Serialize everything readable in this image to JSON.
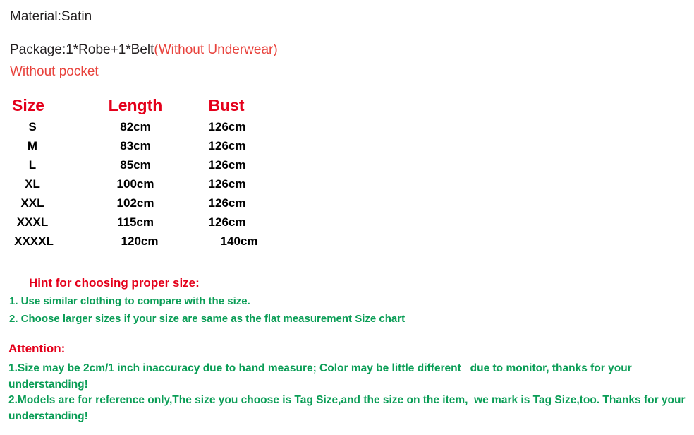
{
  "product_info": {
    "material_line": "Material:Satin",
    "package_label": "Package:1*Robe+1*Belt",
    "package_note": "(Without Underwear)",
    "pocket_note": "Without pocket"
  },
  "size_chart": {
    "headers": {
      "size": "Size",
      "length": "Length",
      "bust": "Bust"
    },
    "rows": [
      {
        "size": "S",
        "length": "82cm",
        "bust": "126cm"
      },
      {
        "size": "M",
        "length": "83cm",
        "bust": "126cm"
      },
      {
        "size": "L",
        "length": "85cm",
        "bust": "126cm"
      },
      {
        "size": "XL",
        "length": "100cm",
        "bust": "126cm"
      },
      {
        "size": "XXL",
        "length": "102cm",
        "bust": "126cm"
      },
      {
        "size": "XXXL",
        "length": "115cm",
        "bust": "126cm"
      },
      {
        "size": "XXXXL",
        "length": "120cm",
        "bust": "140cm"
      }
    ]
  },
  "hint": {
    "title": "Hint for choosing proper size:",
    "items": [
      "1. Use similar clothing to compare with the size.",
      "2. Choose larger sizes if your size are same as the flat measurement Size chart"
    ]
  },
  "attention": {
    "title": "Attention:",
    "items": [
      "1.Size may be 2cm/1 inch inaccuracy due to hand measure; Color may be little different   due to monitor, thanks for your understanding!",
      "2.Models are for reference only,The size you choose is Tag Size,and the size on the item,  we mark is Tag Size,too. Thanks for your understanding!"
    ]
  },
  "colors": {
    "background": "#ffffff",
    "text": "#231f20",
    "heading_red": "#e4001b",
    "note_red": "#e8423c",
    "green": "#0a9d56"
  }
}
